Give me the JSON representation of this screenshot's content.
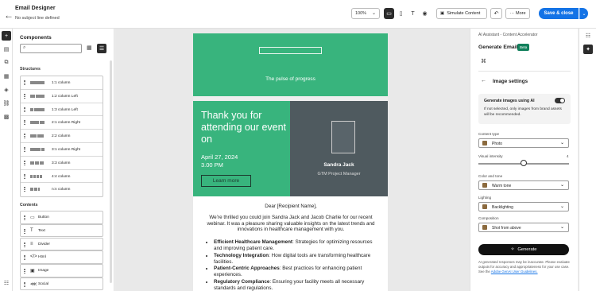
{
  "header": {
    "title": "Email Designer",
    "subtitle": "No subject line defined",
    "zoom": "100%",
    "simulate_label": "Simulate Content",
    "more_label": "More",
    "save_label": "Save & close",
    "accent": "#1473e6"
  },
  "left_rail": {
    "icons": [
      "add-icon",
      "layout-icon",
      "fragments-icon",
      "assets-icon",
      "layers-icon",
      "links-icon",
      "personalization-icon",
      "settings-icon"
    ]
  },
  "components": {
    "title": "Components",
    "search_placeholder": "",
    "structures_title": "Structures",
    "structures": [
      {
        "label": "1:1 column",
        "cols": [
          18
        ]
      },
      {
        "label": "1:2 column Left",
        "cols": [
          6,
          11
        ]
      },
      {
        "label": "1:3 column Left",
        "cols": [
          4,
          13
        ]
      },
      {
        "label": "2:1 column Right",
        "cols": [
          11,
          6
        ]
      },
      {
        "label": "2:2 column",
        "cols": [
          8,
          8
        ]
      },
      {
        "label": "3:1 column Right",
        "cols": [
          13,
          4
        ]
      },
      {
        "label": "3:3 column",
        "cols": [
          5,
          5,
          5
        ]
      },
      {
        "label": "4:4 column",
        "cols": [
          3,
          3,
          3,
          3
        ]
      },
      {
        "label": "n:n column",
        "cols": [
          4,
          4,
          2
        ]
      }
    ],
    "contents_title": "Contents",
    "contents": [
      {
        "label": "Button",
        "icon": "▭"
      },
      {
        "label": "Text",
        "icon": "T"
      },
      {
        "label": "Divider",
        "icon": "≡"
      },
      {
        "label": "Html",
        "icon": "</>"
      },
      {
        "label": "Image",
        "icon": "▣"
      },
      {
        "label": "Social",
        "icon": "⋘"
      }
    ]
  },
  "email": {
    "tagline": "The pulse of progress",
    "event_title": "Thank you for attending  our event on",
    "event_date": "April 27, 2024",
    "event_time": "3.00 PM",
    "cta_label": "Learn more",
    "speaker_name": "Sandra Jack",
    "speaker_role": "GTM Project Manager",
    "greeting": "Dear [Recipient Name],",
    "intro": "We’re thrilled you could join Sandra Jack and Jacob Charlie for our recent webinar. It was a pleasure sharing valuable insights on the latest trends and innovations in healthcare management with you.",
    "bullets": [
      {
        "bold": "Efficient Healthcare Management",
        "text": ": Strategies for optimizing resources and improving patient care."
      },
      {
        "bold": "Technology Integration",
        "text": ": How digital tools are transforming healthcare facilities."
      },
      {
        "bold": "Patient-Centric Approaches",
        "text": ": Best practices for enhancing patient experiences."
      },
      {
        "bold": "Regulatory Compliance",
        "text": ": Ensuring your facility meets all necessary standards and regulations."
      }
    ],
    "brand_green": "#38b47d",
    "speaker_bg": "#4f5a5f"
  },
  "ai_panel": {
    "breadcrumb": "AI Assistant - Content Accelerator",
    "title": "Generate Email",
    "badge": "Beta",
    "section_title": "Image settings",
    "gen_images_label": "Generate images using AI",
    "gen_images_on": true,
    "gen_images_note": "If not selected, only images from brand assets will be recommended.",
    "content_type_label": "Content type",
    "content_type_value": "Photo",
    "visual_intensity_label": "Visual intensity",
    "visual_intensity_value": "4",
    "visual_intensity_level": 0.5,
    "color_tone_label": "Color and tone",
    "color_tone_value": "Warm tone",
    "lighting_label": "Lighting",
    "lighting_value": "Backlighting",
    "composition_label": "Composition",
    "composition_value": "Shot from above",
    "generate_label": "Generate",
    "disclaimer": "AI generated responses may be inaccurate. Please evaluate outputs for accuracy and appropriateness for your use case. See the",
    "disclaimer_link": "Adobe GenAI User Guidelines."
  }
}
